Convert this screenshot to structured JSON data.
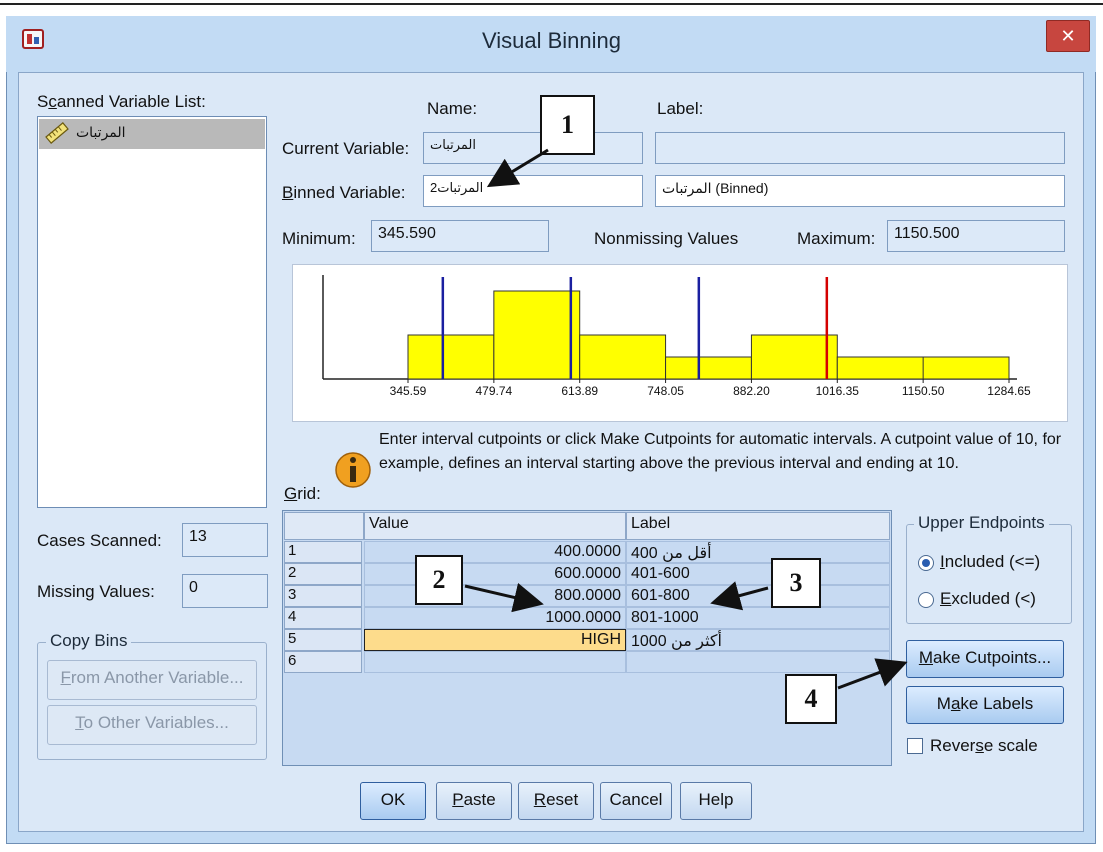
{
  "window": {
    "title": "Visual Binning",
    "close_symbol": "✕"
  },
  "scanned": {
    "title_prefix": "S",
    "title_accel": "c",
    "title_rest": "anned Variable List:",
    "items": [
      "المرتبات"
    ]
  },
  "variable": {
    "name_header": "Name:",
    "label_header": "Label:",
    "current_label": "Current Variable:",
    "current_name": "المرتبات",
    "current_label_value": "",
    "binned_label_accel": "B",
    "binned_label_rest": "inned Variable:",
    "binned_name": "المرتبات2",
    "binned_label_value": "المرتبات (Binned)"
  },
  "stats": {
    "min_label": "Minimum:",
    "min_value": "345.590",
    "nonmissing_label": "Nonmissing Values",
    "max_label": "Maximum:",
    "max_value": "1150.500"
  },
  "chart_data": {
    "type": "bar",
    "x_tick_labels": [
      "345.59",
      "479.74",
      "613.89",
      "748.05",
      "882.20",
      "1016.35",
      "1150.50",
      "1284.65"
    ],
    "bins": [
      {
        "from": 345.59,
        "to": 479.74,
        "height": 2
      },
      {
        "from": 479.74,
        "to": 613.89,
        "height": 4
      },
      {
        "from": 613.89,
        "to": 748.05,
        "height": 2
      },
      {
        "from": 748.05,
        "to": 882.2,
        "height": 1
      },
      {
        "from": 882.2,
        "to": 1016.35,
        "height": 2
      },
      {
        "from": 1016.35,
        "to": 1284.65,
        "height": 1
      }
    ],
    "cutpoints": [
      {
        "value": 400,
        "color": "#1a1fa0"
      },
      {
        "value": 600,
        "color": "#1a1fa0"
      },
      {
        "value": 800,
        "color": "#1a1fa0"
      },
      {
        "value": 1000,
        "color": "#d40000"
      }
    ],
    "xlim": [
      345.59,
      1284.65
    ],
    "bar_color": "#ffff00"
  },
  "info": {
    "text": "Enter interval cutpoints or click Make Cutpoints for automatic intervals. A cutpoint value of 10, for example, defines an interval starting above the previous interval and ending at 10."
  },
  "grid": {
    "label_accel": "G",
    "label_rest": "rid:",
    "headers": [
      "Value",
      "Label"
    ],
    "rows": [
      {
        "num": "1",
        "value": "400.0000",
        "label": "أقل من 400"
      },
      {
        "num": "2",
        "value": "600.0000",
        "label": "401-600"
      },
      {
        "num": "3",
        "value": "800.0000",
        "label": "601-800"
      },
      {
        "num": "4",
        "value": "1000.0000",
        "label": "801-1000"
      },
      {
        "num": "5",
        "value": "HIGH",
        "label": "أكثر من 1000"
      },
      {
        "num": "6",
        "value": "",
        "label": ""
      }
    ]
  },
  "endpoints": {
    "title": "Upper Endpoints",
    "included_accel": "I",
    "included_rest": "ncluded (<=)",
    "excluded_accel": "E",
    "excluded_rest": "xcluded (<)"
  },
  "cases": {
    "scanned_label": "Cases Scanned:",
    "scanned_value": "13",
    "missing_label": "Missing Values:",
    "missing_value": "0"
  },
  "copybins": {
    "title": "Copy Bins",
    "from_accel": "F",
    "from_rest": "rom Another Variable...",
    "to_accel": "T",
    "to_rest": "o Other Variables..."
  },
  "buttons": {
    "make_cutpoints_accel": "M",
    "make_cutpoints_rest": "ake Cutpoints...",
    "make_labels_pre": "M",
    "make_labels_accel": "a",
    "make_labels_rest": "ke Labels",
    "reverse_pre": "Rever",
    "reverse_accel": "s",
    "reverse_rest": "e scale",
    "ok": "OK",
    "paste_accel": "P",
    "paste_rest": "aste",
    "reset_accel": "R",
    "reset_rest": "eset",
    "cancel": "Cancel",
    "help": "Help"
  },
  "callouts": [
    "1",
    "2",
    "3",
    "4"
  ]
}
